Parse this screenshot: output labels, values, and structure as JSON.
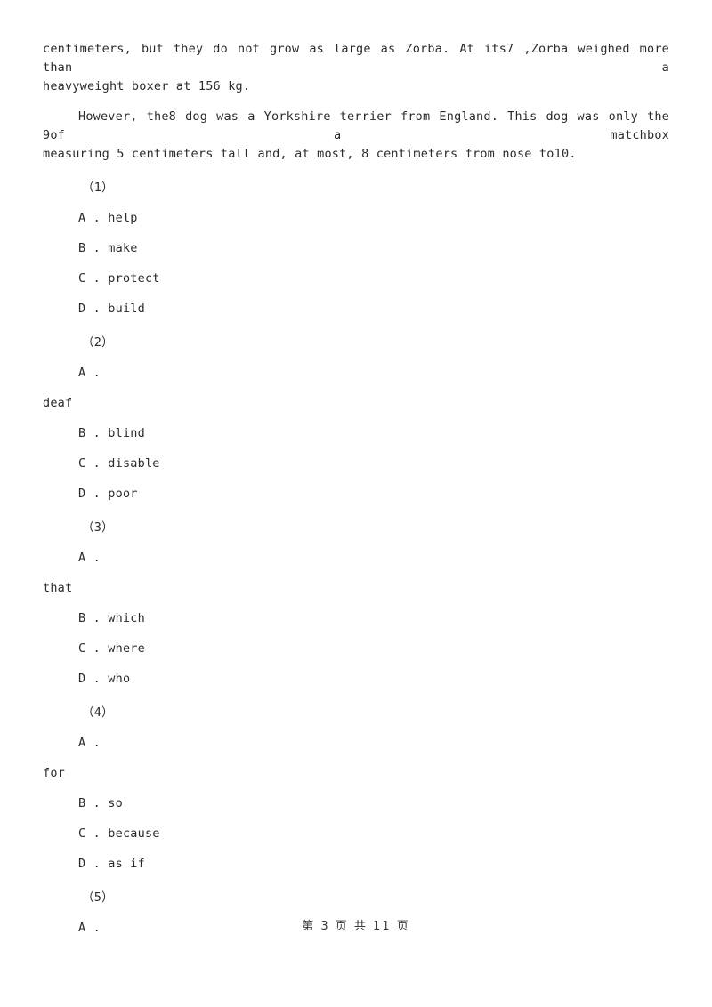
{
  "document": {
    "paragraphs": [
      {
        "id": "para-1",
        "line1": "centimeters, but they do not grow as large as Zorba.  At its7 ,Zorba weighed more than a",
        "line2": "heavyweight boxer at 156 kg."
      },
      {
        "id": "para-2",
        "line1": "However, the8 dog was a Yorkshire terrier from England.  This dog was only the 9of a matchbox",
        "line2": "measuring 5 centimeters tall and, at most, 8 centimeters from nose to10."
      }
    ],
    "questions": [
      {
        "number": "（1）",
        "options": [
          {
            "label": "A . help"
          },
          {
            "label": "B . make"
          },
          {
            "label": "C . protect"
          },
          {
            "label": "D . build"
          }
        ],
        "orphan": null
      },
      {
        "number": "（2）",
        "options": [
          {
            "label": "A ."
          },
          {
            "label": "B . blind"
          },
          {
            "label": "C . disable"
          },
          {
            "label": "D . poor"
          }
        ],
        "orphan": "deaf"
      },
      {
        "number": "（3）",
        "options": [
          {
            "label": "A ."
          },
          {
            "label": "B . which"
          },
          {
            "label": "C . where"
          },
          {
            "label": "D . who"
          }
        ],
        "orphan": "that"
      },
      {
        "number": "（4）",
        "options": [
          {
            "label": "A ."
          },
          {
            "label": "B . so"
          },
          {
            "label": "C . because"
          },
          {
            "label": "D . as if"
          }
        ],
        "orphan": "for"
      },
      {
        "number": "（5）",
        "options": [
          {
            "label": "A ."
          }
        ],
        "orphan": null
      }
    ],
    "footer": {
      "text": "第 3 页 共 11 页",
      "current_page": "3",
      "total_pages": "11"
    }
  }
}
